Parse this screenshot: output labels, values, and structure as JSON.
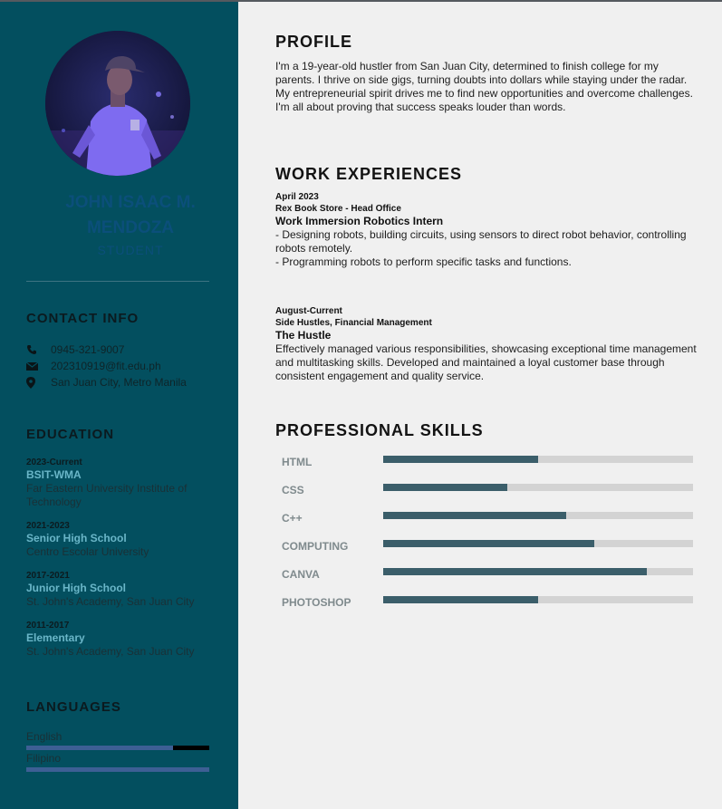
{
  "profile_card": {
    "name_line1": "JOHN ISAAC M.",
    "name_line2": "MENDOZA",
    "role": "STUDENT"
  },
  "contact": {
    "heading": "CONTACT INFO",
    "phone": "0945-321-9007",
    "email": "202310919@fit.edu.ph",
    "location": "San Juan City, Metro Manila"
  },
  "education": {
    "heading": "EDUCATION",
    "items": [
      {
        "years": "2023-Current",
        "degree": "BSIT-WMA",
        "school": "Far Eastern University Institute of Technology"
      },
      {
        "years": "2021-2023",
        "degree": "Senior High School",
        "school": "Centro Escolar University"
      },
      {
        "years": "2017-2021",
        "degree": "Junior High School",
        "school": "St. John's Academy, San Juan City"
      },
      {
        "years": "2011-2017",
        "degree": "Elementary",
        "school": "St. John's Academy, San Juan City"
      }
    ]
  },
  "languages": {
    "heading": "LANGUAGES",
    "items": [
      {
        "name": "English",
        "level": 0.8
      },
      {
        "name": "Filipino",
        "level": 1.0
      }
    ]
  },
  "profile": {
    "heading": "PROFILE",
    "paragraph1": "I'm a 19-year-old hustler from San Juan City, determined to finish college for my parents. I thrive on side gigs, turning doubts into dollars while staying under the radar.",
    "paragraph2": "My entrepreneurial spirit drives me to find new opportunities and overcome challenges. I'm all about proving that success speaks louder than words."
  },
  "work": {
    "heading": "WORK EXPERIENCES",
    "jobs": [
      {
        "date": "April 2023",
        "company": "Rex Book Store - Head Office",
        "title": "Work Immersion Robotics Intern",
        "line1": "- Designing robots, building circuits, using sensors to direct robot behavior, controlling robots remotely.",
        "line2": "- Programming robots to perform specific tasks and functions."
      },
      {
        "date": "August-Current",
        "company": "Side Hustles, Financial Management",
        "title": "The Hustle",
        "line1": "Effectively managed various responsibilities, showcasing exceptional time management and multitasking skills. Developed and maintained a loyal customer base through consistent engagement and quality service.",
        "line2": ""
      }
    ]
  },
  "skills": {
    "heading": "PROFESSIONAL SKILLS",
    "items": [
      {
        "name": "HTML",
        "level": 0.5
      },
      {
        "name": "CSS",
        "level": 0.4
      },
      {
        "name": "C++",
        "level": 0.59
      },
      {
        "name": "COMPUTING",
        "level": 0.68
      },
      {
        "name": "CANVA",
        "level": 0.85
      },
      {
        "name": "PHOTOSHOP",
        "level": 0.5
      }
    ]
  },
  "colors": {
    "sidebar": "#034f5f",
    "accent": "#6ab6c8",
    "skill_fill": "#3b5e6a",
    "lang_fill": "#3d5f94"
  }
}
